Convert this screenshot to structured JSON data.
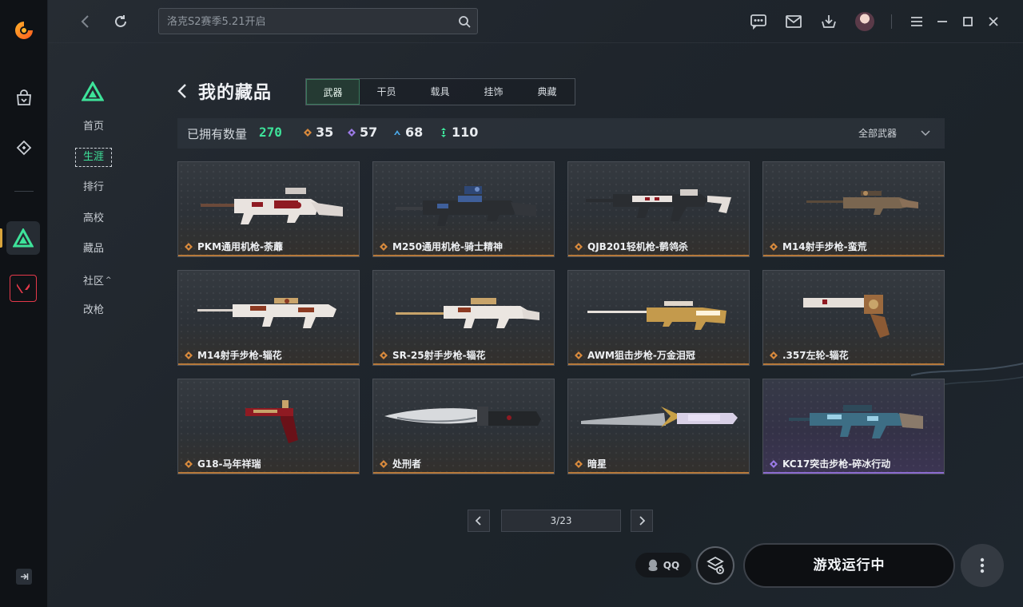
{
  "search": {
    "placeholder": "洛克S2赛季5.21开启"
  },
  "sidebar": {
    "items": [
      {
        "label": "首页",
        "active": false
      },
      {
        "label": "生涯",
        "active": true
      },
      {
        "label": "排行",
        "active": false
      },
      {
        "label": "高校",
        "active": false
      },
      {
        "label": "藏品",
        "active": false
      },
      {
        "label": "社区",
        "active": false
      },
      {
        "label": "改枪",
        "active": false
      }
    ]
  },
  "collection": {
    "title": "我的藏品",
    "tabs": [
      "武器",
      "干员",
      "载具",
      "挂饰",
      "典藏"
    ],
    "active_tab": "武器",
    "owned_label": "已拥有数量",
    "owned_total": "270",
    "counts": [
      {
        "value": "35",
        "color": "#d98a3c"
      },
      {
        "value": "57",
        "color": "#9b7ae6"
      },
      {
        "value": "68",
        "color": "#4aa8e8"
      },
      {
        "value": "110",
        "color": "#3ee39a"
      }
    ],
    "filter": "全部武器"
  },
  "items": [
    {
      "name": "PKM通用机枪-荼蘼",
      "rarity": "orange",
      "icon": "machine-gun"
    },
    {
      "name": "M250通用机枪-骑士精神",
      "rarity": "orange",
      "icon": "machine-gun"
    },
    {
      "name": "QJB201轻机枪-鹡鸰杀",
      "rarity": "orange",
      "icon": "light-machine-gun"
    },
    {
      "name": "M14射手步枪-蛮荒",
      "rarity": "orange",
      "icon": "marksman-rifle"
    },
    {
      "name": "M14射手步枪-辎花",
      "rarity": "orange",
      "icon": "marksman-rifle"
    },
    {
      "name": "SR-25射手步枪-辎花",
      "rarity": "orange",
      "icon": "marksman-rifle"
    },
    {
      "name": "AWM狙击步枪-万金泪冠",
      "rarity": "orange",
      "icon": "sniper-rifle"
    },
    {
      "name": ".357左轮-辎花",
      "rarity": "orange",
      "icon": "revolver"
    },
    {
      "name": "G18-马年祥瑞",
      "rarity": "orange",
      "icon": "pistol"
    },
    {
      "name": "处刑者",
      "rarity": "orange",
      "icon": "knife"
    },
    {
      "name": "暗星",
      "rarity": "orange",
      "icon": "blade"
    },
    {
      "name": "KC17突击步枪-碎冰行动",
      "rarity": "purple",
      "icon": "assault-rifle"
    }
  ],
  "pagination": {
    "page": "3/23"
  },
  "footer": {
    "qq_label": "QQ",
    "play_label": "游戏运行中"
  }
}
